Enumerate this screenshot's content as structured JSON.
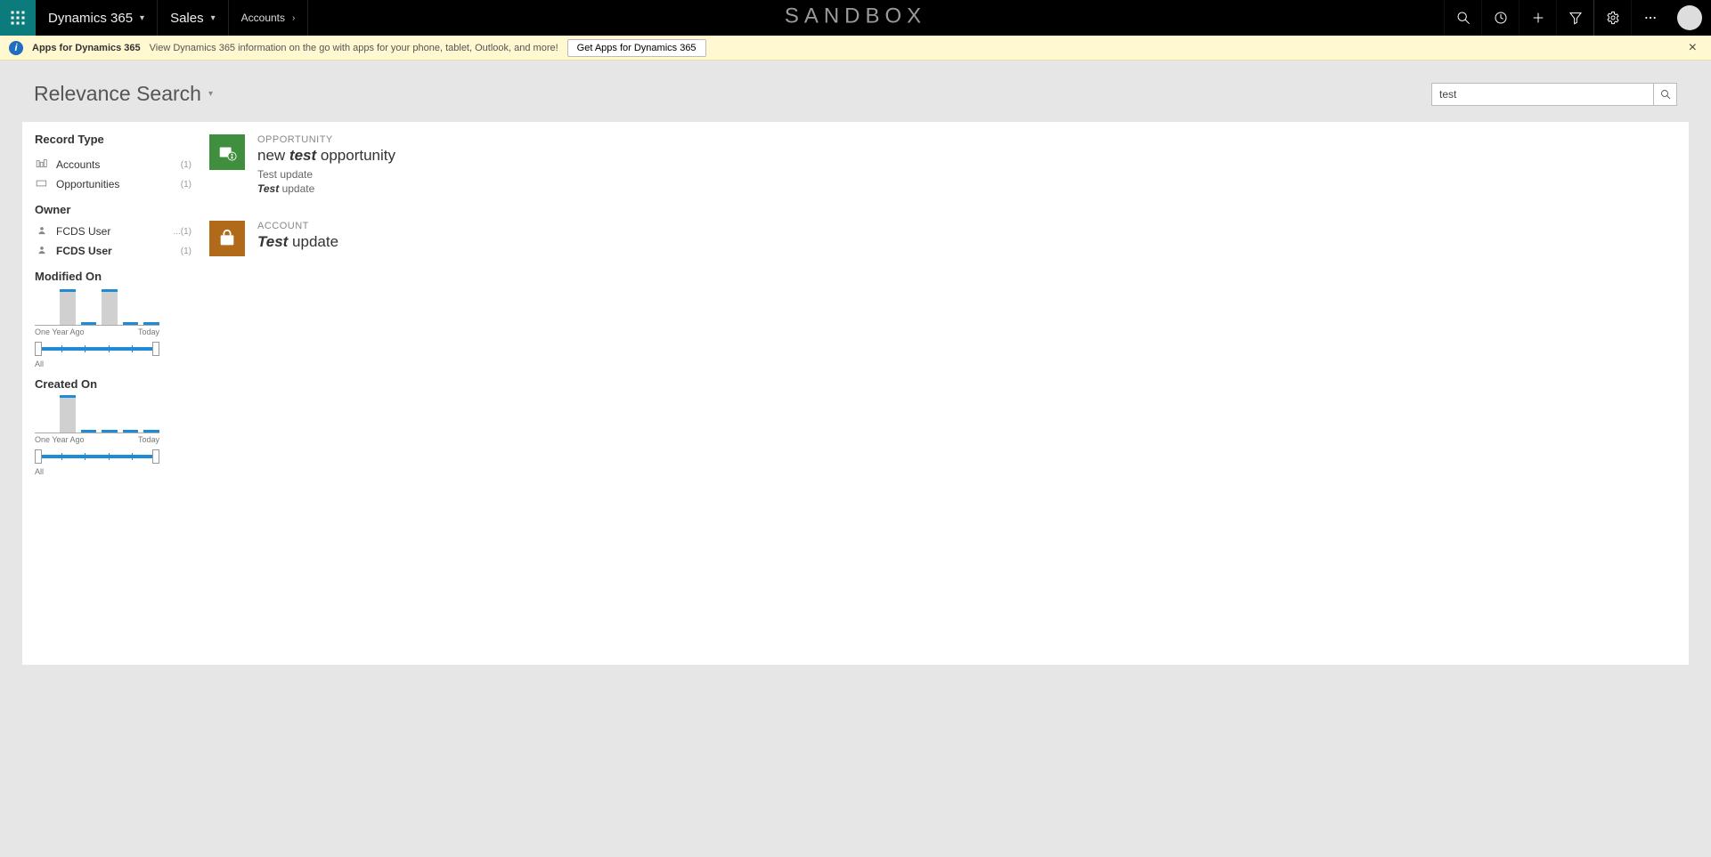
{
  "topbar": {
    "brand": "Dynamics 365",
    "area": "Sales",
    "breadcrumb": "Accounts",
    "watermark": "SANDBOX"
  },
  "notif": {
    "title": "Apps for Dynamics 365",
    "text": "View Dynamics 365 information on the go with apps for your phone, tablet, Outlook, and more!",
    "button": "Get Apps for Dynamics 365"
  },
  "search": {
    "heading": "Relevance Search",
    "value": "test"
  },
  "facets": {
    "record_type_label": "Record Type",
    "items": [
      {
        "icon": "building",
        "label": "Accounts",
        "count": "(1)"
      },
      {
        "icon": "rect",
        "label": "Opportunities",
        "count": "(1)"
      }
    ],
    "owner_label": "Owner",
    "owners": [
      {
        "label": "FCDS User",
        "count": "...(1)"
      },
      {
        "label": "FCDS User",
        "count": "(1)",
        "bold": true
      }
    ],
    "modified_label": "Modified On",
    "created_label": "Created On",
    "axis_left": "One Year Ago",
    "axis_right": "Today",
    "slider_label": "All"
  },
  "results": [
    {
      "type": "OPPORTUNITY",
      "icon": "opportunity",
      "title_pre": "new ",
      "title_hl": "test",
      "title_post": " opportunity",
      "snippet1": "Test update",
      "snippet2_hl": "Test",
      "snippet2_post": " update"
    },
    {
      "type": "ACCOUNT",
      "icon": "account",
      "title_pre": "",
      "title_hl": "Test",
      "title_post": " update"
    }
  ],
  "chart_data": [
    {
      "name": "Modified On",
      "type": "bar",
      "xlabel_left": "One Year Ago",
      "xlabel_right": "Today",
      "bars": [
        40,
        0,
        40,
        0,
        0
      ],
      "ticks_only": [
        false,
        true,
        false,
        true,
        true
      ],
      "slider_range": "All"
    },
    {
      "name": "Created On",
      "type": "bar",
      "xlabel_left": "One Year Ago",
      "xlabel_right": "Today",
      "bars": [
        42,
        0,
        0,
        0,
        0
      ],
      "ticks_only": [
        false,
        true,
        true,
        true,
        true
      ],
      "slider_range": "All"
    }
  ]
}
